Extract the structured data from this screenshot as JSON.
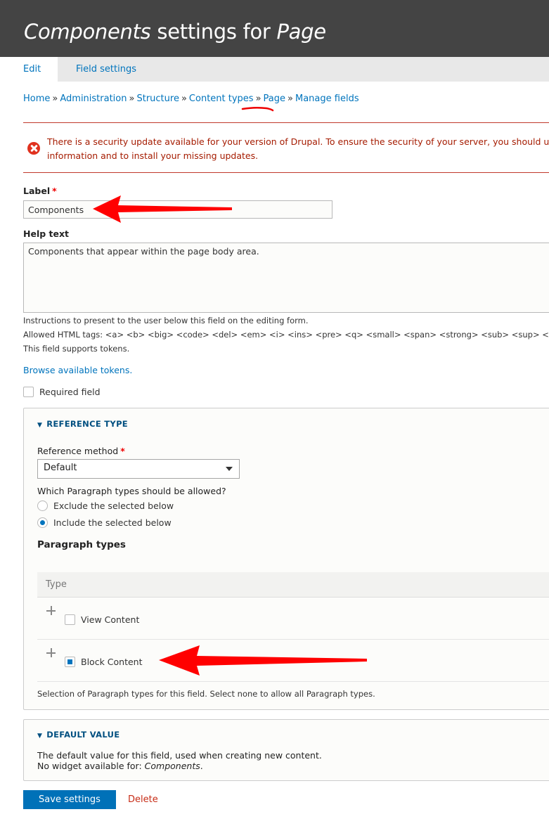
{
  "header": {
    "title_field": "Components",
    "title_middle": " settings for ",
    "title_bundle": "Page"
  },
  "tabs": [
    {
      "label": "Edit",
      "active": true
    },
    {
      "label": "Field settings",
      "active": false
    }
  ],
  "breadcrumb": {
    "items": [
      "Home",
      "Administration",
      "Structure",
      "Content types",
      "Page",
      "Manage fields"
    ],
    "separator": "»"
  },
  "alert": {
    "type": "error",
    "icon": "error-circle-x-icon",
    "line1": "There is a security update available for your version of Drupal. To ensure the security of your server, you should updat",
    "line2": "information and to install your missing updates."
  },
  "form": {
    "label_field": {
      "label": "Label",
      "required_mark": "*",
      "value": "Components"
    },
    "help_text": {
      "label": "Help text",
      "value": "Components that appear within the page body area.",
      "description_lines": [
        "Instructions to present to the user below this field on the editing form.",
        "Allowed HTML tags: <a> <b> <big> <code> <del> <em> <i> <ins> <pre> <q> <small> <span> <strong> <sub> <sup> <tt> <ol> <ul> <l",
        "This field supports tokens."
      ]
    },
    "browse_tokens_link": "Browse available tokens.",
    "required_field": {
      "label": "Required field",
      "checked": false
    }
  },
  "reference_type": {
    "legend": "REFERENCE TYPE",
    "toggle_icon": "▼",
    "method": {
      "label": "Reference method",
      "required_mark": "*",
      "selected": "Default"
    },
    "allowed_question": "Which Paragraph types should be allowed?",
    "radios": [
      {
        "label": "Exclude the selected below",
        "checked": false
      },
      {
        "label": "Include the selected below",
        "checked": true
      }
    ],
    "paragraph_types_heading": "Paragraph types",
    "table": {
      "header": "Type",
      "rows": [
        {
          "label": "View Content",
          "checked": false
        },
        {
          "label": "Block Content",
          "checked": true
        }
      ]
    },
    "description": "Selection of Paragraph types for this field. Select none to allow all Paragraph types."
  },
  "default_value": {
    "legend": "DEFAULT VALUE",
    "toggle_icon": "▼",
    "line1": "The default value for this field, used when creating new content.",
    "line2_prefix": "No widget available for: ",
    "line2_em": "Components",
    "line2_suffix": "."
  },
  "actions": {
    "save_label": "Save settings",
    "delete_label": "Delete"
  },
  "annotations": {
    "arrow_color": "#ff0000"
  }
}
